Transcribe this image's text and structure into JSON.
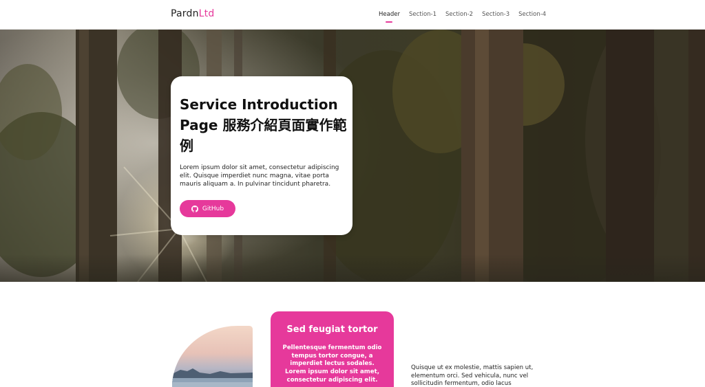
{
  "brand": {
    "part1": "Pardn",
    "part2": "Ltd"
  },
  "nav": {
    "items": [
      {
        "label": "Header",
        "active": true
      },
      {
        "label": "Section-1",
        "active": false
      },
      {
        "label": "Section-2",
        "active": false
      },
      {
        "label": "Section-3",
        "active": false
      },
      {
        "label": "Section-4",
        "active": false
      }
    ]
  },
  "hero": {
    "title": "Service Introduction Page 服務介紹頁面實作範例",
    "description": "Lorem ipsum dolor sit amet, consectetur adipiscing elit. Quisque imperdiet nunc magna, vitae porta mauris aliquam a. In pulvinar tincidunt pharetra.",
    "button_label": "GitHub",
    "button_icon": "github-icon"
  },
  "section1": {
    "card_title": "Sed feugiat tortor",
    "card_text": "Pellentesque fermentum odio tempus tortor congue, a imperdiet lectus sodales. Lorem ipsum dolor sit amet, consectetur adipiscing elit.",
    "side_text": "Quisque ut ex molestie, mattis sapien ut, elementum orci. Sed vehicula, nunc vel sollicitudin fermentum, odio lacus"
  },
  "colors": {
    "accent": "#e6399b",
    "text": "#222222",
    "background": "#ffffff"
  }
}
